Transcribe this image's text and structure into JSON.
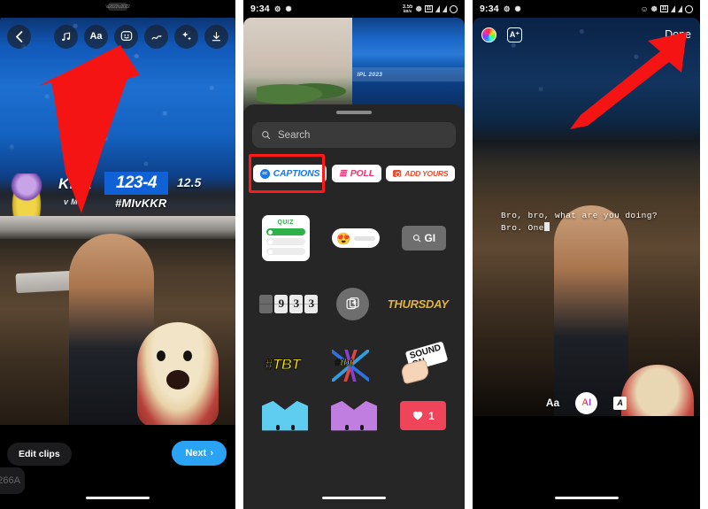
{
  "panels": [
    {
      "name": "video-editor",
      "statusbar": {
        "notch_label": ""
      },
      "toolbar": {
        "back_icon": "chevron-left-icon",
        "items": [
          {
            "icon": "music-note-icon",
            "glyph": "♫"
          },
          {
            "icon": "text-aa-icon",
            "glyph": "Aa"
          },
          {
            "icon": "sticker-smiley-icon",
            "glyph": "☺"
          },
          {
            "icon": "draw-scribble-icon",
            "glyph": "∿"
          },
          {
            "icon": "effects-sparkle-icon",
            "glyph": "✦"
          },
          {
            "icon": "download-icon",
            "glyph": "↓"
          }
        ]
      },
      "scorebug": {
        "team": "KKR",
        "versus": "v MI",
        "score": "123-4",
        "overs": "12.5",
        "hashtag": "#MIvKKR"
      },
      "footer": {
        "edit_clips_label": "Edit clips",
        "next_label": "Next",
        "next_chevron": "›"
      }
    },
    {
      "name": "sticker-tray",
      "statusbar": {
        "time": "9:34",
        "left_icons": [
          "gear-icon",
          "bluetooth-share-icon"
        ],
        "data_rate": "3.55",
        "data_unit": "kB/s",
        "right_icons": [
          "vpn-icon",
          "sim-icon",
          "signal-icon",
          "signal-2-icon",
          "battery-circle-icon"
        ]
      },
      "preview": {
        "band_text": "IPL 2023"
      },
      "search": {
        "placeholder": "Search",
        "icon": "search-icon"
      },
      "sticker_row": [
        {
          "label": "CAPTIONS",
          "icon": "cc-icon",
          "color": "#1877f2",
          "highlighted": true
        },
        {
          "label": "POLL",
          "icon": "poll-icon",
          "color": "#f0316e",
          "highlighted": false
        },
        {
          "label": "ADD YOURS",
          "icon": "camera-icon",
          "color": "#ef4a2a",
          "highlighted": false
        }
      ],
      "row2": {
        "quiz_label": "QUIZ",
        "slider_emoji": "😍",
        "gif_label": "GI",
        "gif_icon": "search-icon"
      },
      "row3": {
        "countdown_digits": [
          "",
          "9",
          "3",
          "3"
        ],
        "add_photo_icon": "add-photo-icon",
        "thursday_label": "THURSDAY"
      },
      "row4": {
        "tbt_label": "#TBT",
        "tbt_burst_label": "#tbt",
        "sound_on_label": "SOUND ON"
      },
      "row5": {
        "heart_blue": "blue-heart-sticker",
        "heart_purple": "purple-heart-sticker",
        "like_count": "1",
        "like_icon": "heart-icon"
      }
    },
    {
      "name": "caption-editor",
      "statusbar": {
        "time": "9:34",
        "left_icons": [
          "gear-icon",
          "bluetooth-share-icon"
        ],
        "right_icons": [
          "contact-icon",
          "vpn-icon",
          "sim-icon",
          "signal-icon",
          "signal-2-icon",
          "battery-circle-icon"
        ]
      },
      "toolbar": {
        "color_wheel_icon": "color-wheel-icon",
        "text_effect_label": "A⁺",
        "done_label": "Done"
      },
      "caption": {
        "text": "Bro, bro, what are you doing? Bro. One"
      },
      "fontbar": {
        "size_label": "Aa",
        "ai_label": "AI",
        "style_label": "A"
      }
    }
  ],
  "annotations": {
    "arrow_color": "#f51414",
    "highlight_color": "#ff1a1a"
  }
}
